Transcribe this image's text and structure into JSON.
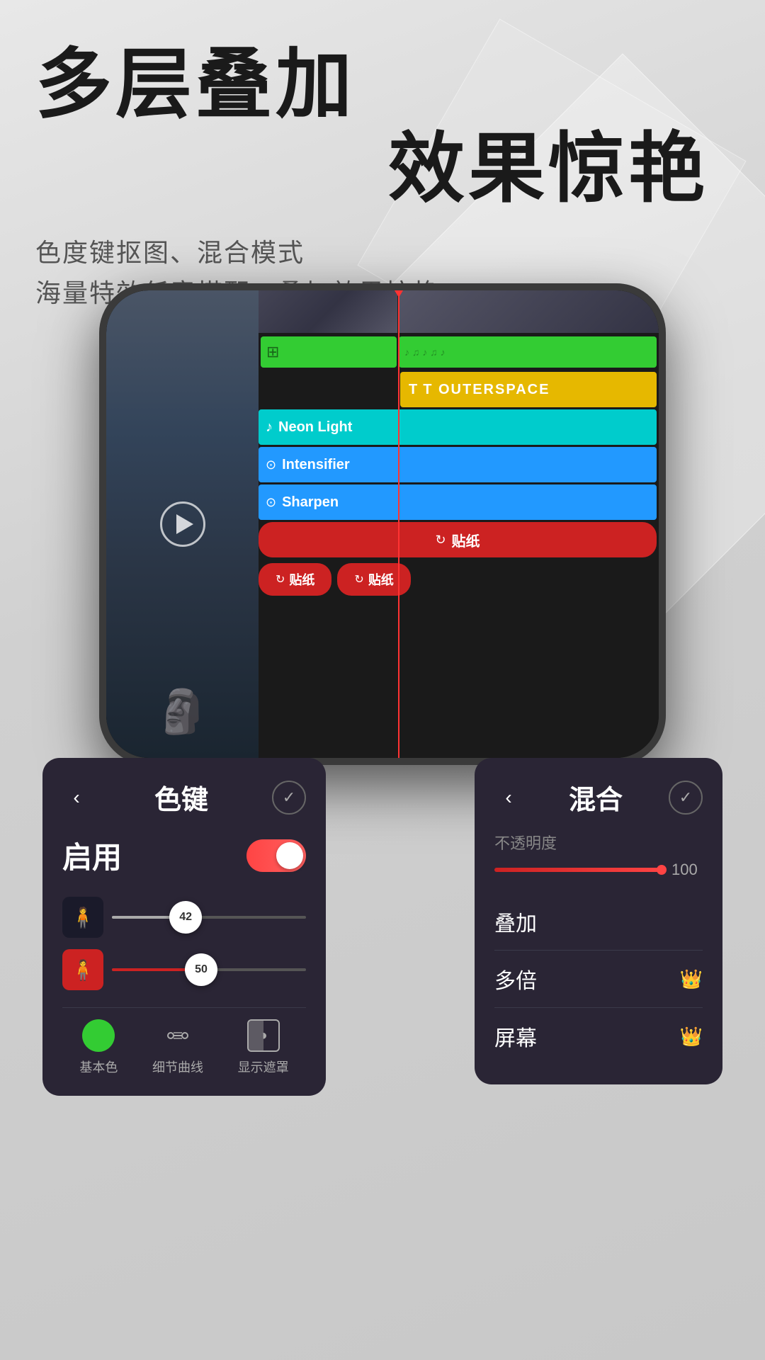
{
  "header": {
    "title_line1": "多层叠加",
    "title_line2": "效果惊艳",
    "subtitle_line1": "色度键抠图、混合模式",
    "subtitle_line2": "海量特效任意搭配，叠加效果惊艳"
  },
  "timeline": {
    "tracks": [
      {
        "id": "video",
        "type": "video-thumb",
        "label": ""
      },
      {
        "id": "green1",
        "type": "green",
        "label": ""
      },
      {
        "id": "outerspace",
        "type": "yellow",
        "label": "T  OUTERSPACE"
      },
      {
        "id": "neon-light",
        "type": "cyan",
        "label": "Neon Light",
        "icon": "♪"
      },
      {
        "id": "intensifier",
        "type": "blue",
        "label": "Intensifier",
        "icon": "⊙"
      },
      {
        "id": "sharpen",
        "type": "blue",
        "label": "Sharpen",
        "icon": "⊙"
      },
      {
        "id": "sticker-full",
        "type": "red-full",
        "label": "贴纸"
      },
      {
        "id": "stickers-two",
        "type": "stickers",
        "label": "贴纸"
      }
    ]
  },
  "color_key_panel": {
    "back_label": "‹",
    "title": "色键",
    "check_label": "✓",
    "enable_label": "启用",
    "slider1_value": "42",
    "slider2_value": "50",
    "tools": [
      {
        "id": "base-color",
        "label": "基本色",
        "icon": "●"
      },
      {
        "id": "curves",
        "label": "细节曲线",
        "icon": "∿"
      },
      {
        "id": "mask",
        "label": "显示遮罩",
        "icon": "◑"
      }
    ]
  },
  "mix_panel": {
    "back_label": "‹",
    "title": "混合",
    "check_label": "✓",
    "opacity_label": "不透明度",
    "opacity_value": "100",
    "options": [
      {
        "id": "overlay",
        "label": "叠加",
        "premium": false
      },
      {
        "id": "multiply",
        "label": "多倍",
        "premium": true
      },
      {
        "id": "screen",
        "label": "屏幕",
        "premium": true
      }
    ]
  },
  "colors": {
    "bg": "#dcdcdc",
    "phone_body": "#2a2a2a",
    "green_track": "#33cc33",
    "yellow_track": "#e6b800",
    "cyan_track": "#00cccc",
    "blue_track": "#2299ff",
    "red_track": "#cc2222",
    "panel_bg": "#2a2535",
    "accent_red": "#ff4444"
  }
}
